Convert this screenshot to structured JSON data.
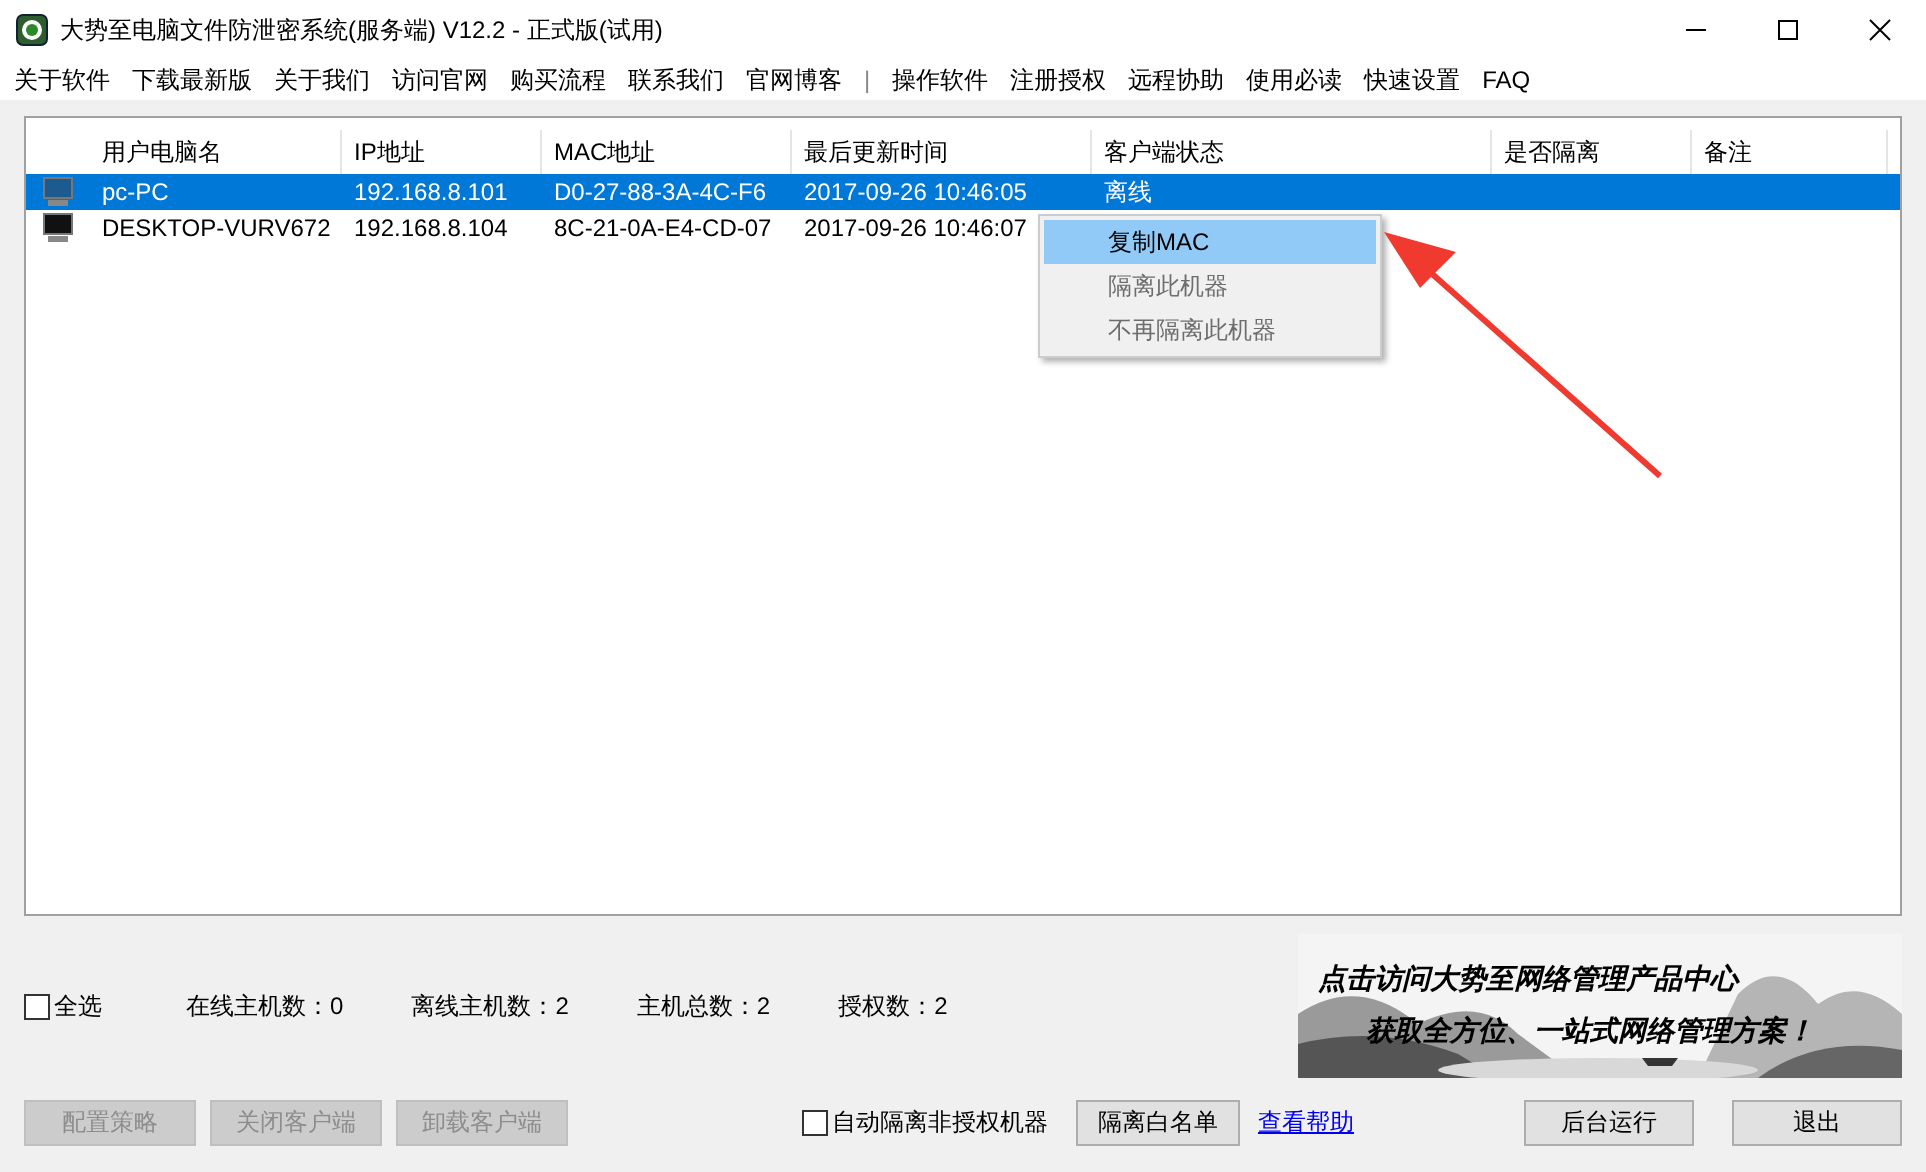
{
  "window": {
    "title": "大势至电脑文件防泄密系统(服务端) V12.2 - 正式版(试用)"
  },
  "menu": [
    "关于软件",
    "下载最新版",
    "关于我们",
    "访问官网",
    "购买流程",
    "联系我们",
    "官网博客",
    "|",
    "操作软件",
    "注册授权",
    "远程协助",
    "使用必读",
    "快速设置",
    "FAQ"
  ],
  "table": {
    "columns": [
      "用户电脑名",
      "IP地址",
      "MAC地址",
      "最后更新时间",
      "客户端状态",
      "是否隔离",
      "备注"
    ],
    "rows": [
      {
        "selected": true,
        "cells": [
          "pc-PC",
          "192.168.8.101",
          "D0-27-88-3A-4C-F6",
          "2017-09-26 10:46:05",
          "离线",
          "",
          ""
        ]
      },
      {
        "selected": false,
        "cells": [
          "DESKTOP-VURV672",
          "192.168.8.104",
          "8C-21-0A-E4-CD-07",
          "2017-09-26 10:46:07",
          "",
          "",
          ""
        ]
      }
    ]
  },
  "context_menu": [
    {
      "label": "复制MAC",
      "disabled": false,
      "selected": true
    },
    {
      "label": "隔离此机器",
      "disabled": true,
      "selected": false
    },
    {
      "label": "不再隔离此机器",
      "disabled": true,
      "selected": false
    }
  ],
  "select_all": {
    "label": "全选",
    "checked": false
  },
  "stats": [
    "在线主机数：0",
    "离线主机数：2",
    "主机总数：2",
    "授权数：2"
  ],
  "banner": {
    "kind": "picture",
    "lines": [
      "点击访问大势至网络管理产品中心",
      "获取全方位、一站式网络管理方案！"
    ]
  },
  "left_buttons": [
    {
      "label": "配置策略",
      "disabled": true
    },
    {
      "label": "关闭客户端",
      "disabled": true
    },
    {
      "label": "卸载客户端",
      "disabled": true
    }
  ],
  "auto_isolate": {
    "label": "自动隔离非授权机器",
    "checked": false
  },
  "whitelist_button": "隔离白名单",
  "help_link": "查看帮助",
  "right_buttons": [
    "后台运行",
    "退出"
  ]
}
